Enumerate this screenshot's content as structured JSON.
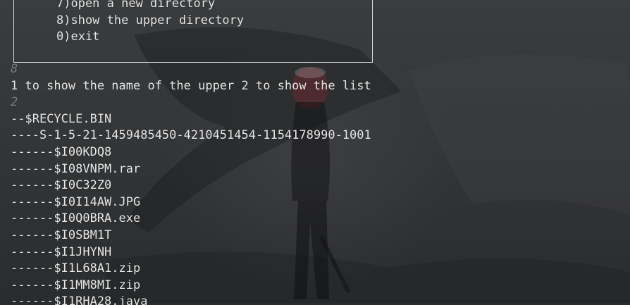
{
  "terminal": {
    "menu_items": [
      "7)open a new directory",
      "8)show the upper directory",
      "0)exit"
    ],
    "lines": [
      {
        "text": "8",
        "kind": "input"
      },
      {
        "text": "1 to show the name of the upper 2 to show the list",
        "kind": "output"
      },
      {
        "text": "2",
        "kind": "input"
      },
      {
        "text": "--$RECYCLE.BIN",
        "kind": "output"
      },
      {
        "text": "----S-1-5-21-1459485450-4210451454-1154178990-1001",
        "kind": "output"
      },
      {
        "text": "------$I00KDQ8",
        "kind": "output"
      },
      {
        "text": "------$I08VNPM.rar",
        "kind": "output"
      },
      {
        "text": "------$I0C32Z0",
        "kind": "output"
      },
      {
        "text": "------$I0I14AW.JPG",
        "kind": "output"
      },
      {
        "text": "------$I0Q0BRA.exe",
        "kind": "output"
      },
      {
        "text": "------$I0SBM1T",
        "kind": "output"
      },
      {
        "text": "------$I1JHYNH",
        "kind": "output"
      },
      {
        "text": "------$I1L68A1.zip",
        "kind": "output"
      },
      {
        "text": "------$I1MM8MI.zip",
        "kind": "output"
      },
      {
        "text": "------$I1RHA28.java",
        "kind": "output"
      }
    ],
    "colors": {
      "text": "#e8e8e8",
      "input_echo": "#7d7f83",
      "border": "#dcdcdc",
      "background": "#333537"
    }
  }
}
